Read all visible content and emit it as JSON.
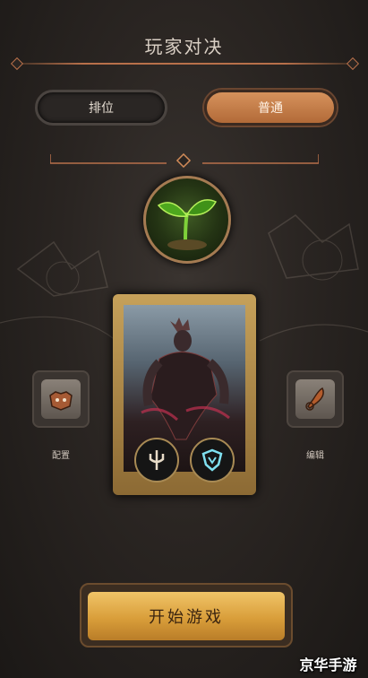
{
  "header": {
    "title": "玩家对决"
  },
  "modes": {
    "ranked_label": "排位",
    "normal_label": "普通",
    "selected": "普通"
  },
  "side": {
    "config_label": "配置",
    "edit_label": "编辑"
  },
  "start": {
    "label": "开始游戏"
  },
  "watermark": {
    "text": "京华手游"
  },
  "colors": {
    "accent": "#c98550",
    "gold": "#e2ac4c",
    "background": "#2a2522"
  }
}
